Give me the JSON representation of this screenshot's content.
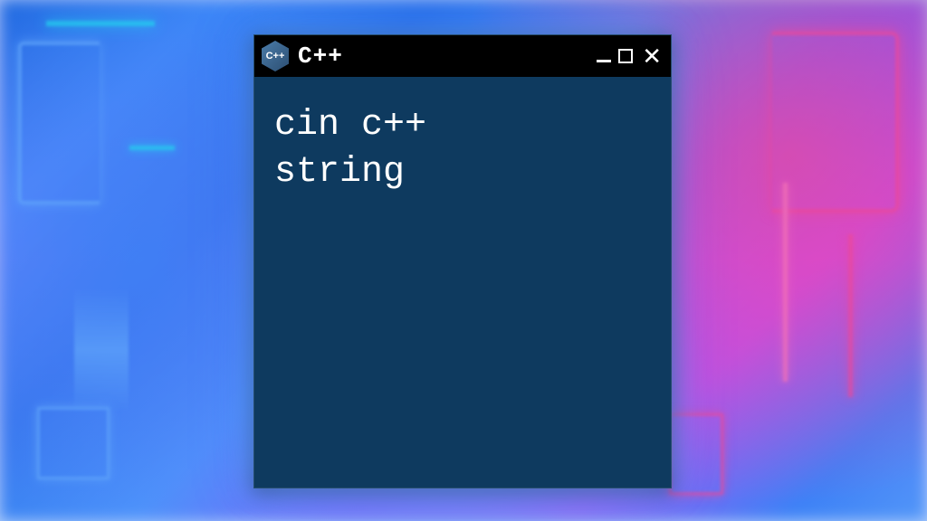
{
  "window": {
    "title": "C++",
    "icon_label": "C++"
  },
  "terminal": {
    "line1": "cin c++",
    "line2": "string"
  }
}
